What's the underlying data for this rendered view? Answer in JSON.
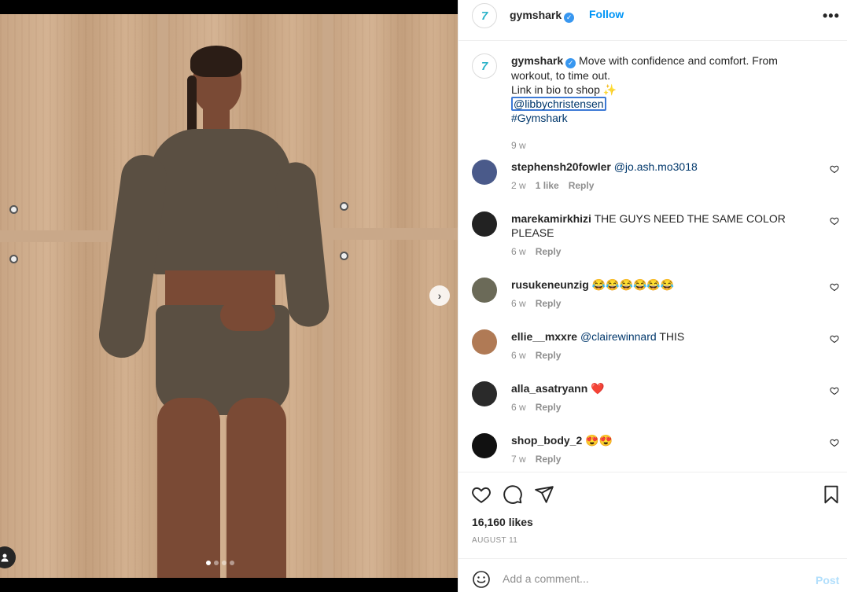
{
  "post": {
    "account": "gymshark",
    "follow_label": "Follow",
    "more_label": "•••",
    "avatar_glyph": "7",
    "verified_glyph": "✓",
    "caption": {
      "text_line1": "Move with confidence and comfort. From workout, to time out.",
      "text_line2": "Link in bio to shop ✨",
      "mention": "@libbychristensen",
      "hashtag": "#Gymshark",
      "time": "9 w"
    },
    "comments": [
      {
        "user": "stephensh20fowler",
        "text": "",
        "mention": "@jo.ash.mo3018",
        "time": "2 w",
        "likes": "1 like",
        "reply": "Reply",
        "avatar_color": "#4a5a8a"
      },
      {
        "user": "marekamirkhizi",
        "text": "THE GUYS NEED THE SAME COLOR PLEASE",
        "mention": "",
        "time": "6 w",
        "likes": "",
        "reply": "Reply",
        "avatar_color": "#222222"
      },
      {
        "user": "rusukeneunzig",
        "text": "😂😂😂😂😂😂",
        "mention": "",
        "time": "6 w",
        "likes": "",
        "reply": "Reply",
        "avatar_color": "#6b6a58"
      },
      {
        "user": "ellie__mxxre",
        "text": "THIS",
        "mention": "@clairewinnard",
        "time": "6 w",
        "likes": "",
        "reply": "Reply",
        "avatar_color": "#b07a55"
      },
      {
        "user": "alla_asatryann",
        "text": "❤️",
        "mention": "",
        "time": "6 w",
        "likes": "",
        "reply": "Reply",
        "avatar_color": "#2a2a2a"
      },
      {
        "user": "shop_body_2",
        "text": "😍😍",
        "mention": "",
        "time": "7 w",
        "likes": "",
        "reply": "Reply",
        "avatar_color": "#111111"
      }
    ],
    "likes_count": "16,160 likes",
    "date": "AUGUST 11",
    "comment_placeholder": "Add a comment...",
    "post_label": "Post",
    "carousel_dots": 4,
    "carousel_active": 1
  },
  "colors": {
    "link": "#0095f6",
    "mention": "#00376b",
    "verified": "#3897f0"
  }
}
